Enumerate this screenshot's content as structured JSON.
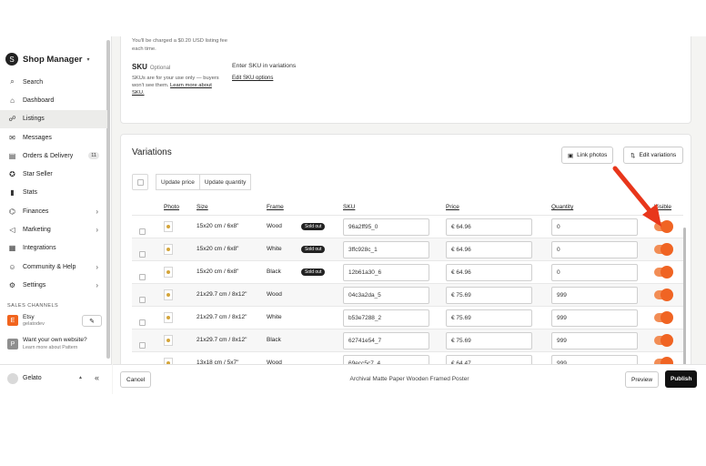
{
  "brand": {
    "title": "Shop Manager",
    "caret": "▾",
    "logo": "S"
  },
  "nav": [
    {
      "label": "Search",
      "icon": "search-icon",
      "glyph": "⌕"
    },
    {
      "label": "Dashboard",
      "icon": "home-icon",
      "glyph": "⌂"
    },
    {
      "label": "Listings",
      "icon": "listings-icon",
      "glyph": "☍",
      "active": true
    },
    {
      "label": "Messages",
      "icon": "mail-icon",
      "glyph": "✉"
    },
    {
      "label": "Orders & Delivery",
      "icon": "orders-icon",
      "glyph": "▤",
      "badge": "11"
    },
    {
      "label": "Star Seller",
      "icon": "star-seller-icon",
      "glyph": "✪"
    },
    {
      "label": "Stats",
      "icon": "stats-icon",
      "glyph": "▮"
    },
    {
      "label": "Finances",
      "icon": "finances-icon",
      "glyph": "⌬",
      "chevron": "›"
    },
    {
      "label": "Marketing",
      "icon": "marketing-icon",
      "glyph": "◁",
      "chevron": "›"
    },
    {
      "label": "Integrations",
      "icon": "integrations-icon",
      "glyph": "▦"
    },
    {
      "label": "Community & Help",
      "icon": "community-icon",
      "glyph": "☺",
      "chevron": "›"
    },
    {
      "label": "Settings",
      "icon": "gear-icon",
      "glyph": "⚙",
      "chevron": "›"
    }
  ],
  "sales_channels": {
    "heading": "SALES CHANNELS",
    "etsy": {
      "logo": "E",
      "name": "Etsy",
      "sub": "gelatodev",
      "edit_glyph": "✎"
    },
    "own": {
      "logo": "P",
      "name": "Want your own website?",
      "sub": "Learn more about Pattern"
    }
  },
  "user": {
    "name": "Gelato",
    "caret": "▲",
    "collapse": "«"
  },
  "listing_fee": {
    "text": "You'll be charged a $0.20 USD listing fee each time."
  },
  "sku_section": {
    "label": "SKU",
    "optional": "Optional",
    "desc": "SKUs are for your use only — buyers won't see them.",
    "learn_link": "Learn more about SKU.",
    "right_text": "Enter SKU in variations",
    "options_link": "Edit SKU options"
  },
  "variations": {
    "title": "Variations",
    "link_photos": "Link photos",
    "link_photos_glyph": "▣",
    "edit_variations": "Edit variations",
    "edit_glyph": "⇅",
    "update_price": "Update price",
    "update_quantity": "Update quantity",
    "columns": {
      "photo": "Photo",
      "size": "Size",
      "frame": "Frame",
      "sku": "SKU",
      "price": "Price",
      "quantity": "Quantity",
      "visible": "Visible"
    },
    "rows": [
      {
        "size": "15x20 cm / 6x8\"",
        "frame": "Wood",
        "sold_out": "Sold out",
        "sku": "96a2ff95_0",
        "price": "€ 64.96",
        "quantity": "0",
        "visible": true
      },
      {
        "size": "15x20 cm / 6x8\"",
        "frame": "White",
        "sold_out": "Sold out",
        "sku": "3ffc928c_1",
        "price": "€ 64.96",
        "quantity": "0",
        "visible": true
      },
      {
        "size": "15x20 cm / 6x8\"",
        "frame": "Black",
        "sold_out": "Sold out",
        "sku": "12b61a30_6",
        "price": "€ 64.96",
        "quantity": "0",
        "visible": true
      },
      {
        "size": "21x29.7 cm / 8x12\"",
        "frame": "Wood",
        "sold_out": "",
        "sku": "04c3a2da_5",
        "price": "€ 75.69",
        "quantity": "999",
        "visible": true
      },
      {
        "size": "21x29.7 cm / 8x12\"",
        "frame": "White",
        "sold_out": "",
        "sku": "b53e7288_2",
        "price": "€ 75.69",
        "quantity": "999",
        "visible": true
      },
      {
        "size": "21x29.7 cm / 8x12\"",
        "frame": "Black",
        "sold_out": "",
        "sku": "62741e54_7",
        "price": "€ 75.69",
        "quantity": "999",
        "visible": true
      },
      {
        "size": "13x18 cm / 5x7\"",
        "frame": "Wood",
        "sold_out": "",
        "sku": "69ecc5c7_4",
        "price": "€ 64.47",
        "quantity": "999",
        "visible": true
      }
    ]
  },
  "footer": {
    "cancel": "Cancel",
    "title": "Archival Matte Paper Wooden Framed Poster",
    "preview": "Preview",
    "publish": "Publish"
  },
  "colors": {
    "toggle_on": "#f06423",
    "annotation_arrow": "#e8361b",
    "etsy": "#f1641e"
  }
}
